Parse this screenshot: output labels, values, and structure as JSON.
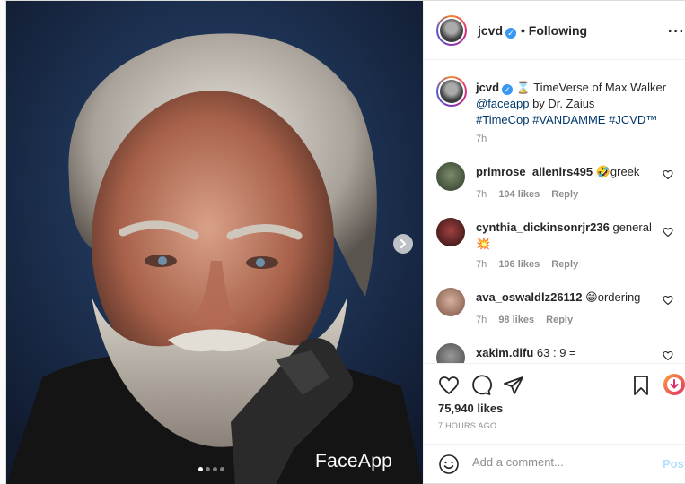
{
  "post": {
    "username": "jcvd",
    "verified": true,
    "following": "• Following",
    "more_icon": "more-horizontal-icon"
  },
  "media": {
    "watermark": "FaceApp",
    "slide_count": 4,
    "active_slide": 1,
    "next_icon": "chevron-right-icon"
  },
  "caption": {
    "username": "jcvd",
    "emoji": "⌛",
    "line1": "TimeVerse of Max Walker",
    "mention": "@faceapp",
    "line2": " by Dr. Zaius",
    "hashtags": "#TimeCop #VANDAMME #JCVD™",
    "time": "7h"
  },
  "comments": [
    {
      "username": "primrose_allenlrs495",
      "emoji": "🤣",
      "text": "greek",
      "time": "7h",
      "likes": "104 likes",
      "reply": "Reply"
    },
    {
      "username": "cynthia_dickinsonrjr236",
      "text": "general",
      "emoji": "💥",
      "time": "7h",
      "likes": "106 likes",
      "reply": "Reply"
    },
    {
      "username": "ava_oswaldlz26112",
      "emoji": "😁",
      "text": "ordering",
      "time": "7h",
      "likes": "98 likes",
      "reply": "Reply"
    },
    {
      "username": "xakim.difu",
      "text": "63 : 9 ="
    }
  ],
  "actions": {
    "like_icon": "heart-icon",
    "comment_icon": "comment-icon",
    "share_icon": "paper-plane-icon",
    "save_icon": "bookmark-icon",
    "likes": "75,940 likes",
    "ago": "7 HOURS AGO"
  },
  "add_comment": {
    "placeholder": "Add a comment...",
    "post_label": "Post",
    "emoji_icon": "smiley-icon"
  },
  "colors": {
    "link": "#00376b",
    "verified": "#3897f0",
    "post_disabled": "#b2dffc",
    "muted": "#8e8e8e"
  }
}
